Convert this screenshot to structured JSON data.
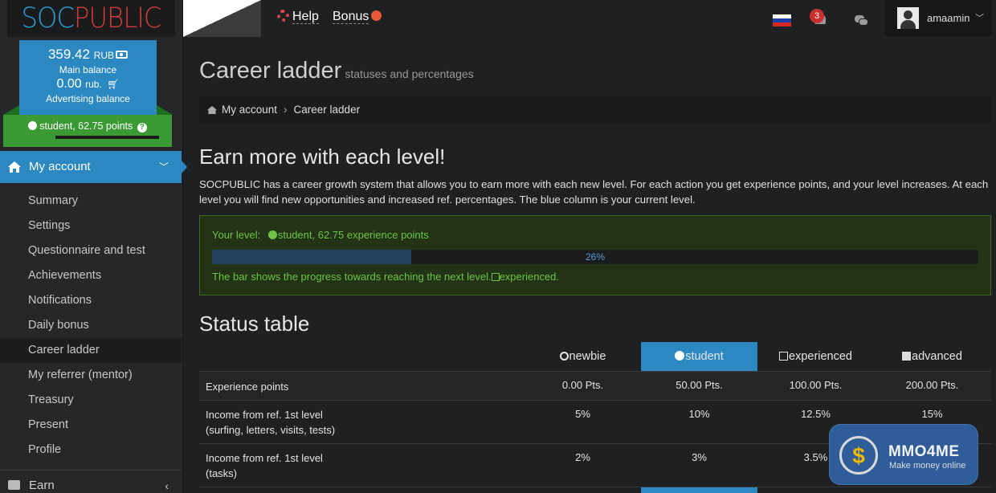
{
  "brand": {
    "part1": "SOC",
    "part2": "PUBLIC"
  },
  "balance": {
    "main_amount": "359.42",
    "main_currency": "RUB",
    "main_label": "Main balance",
    "adv_amount": "0.00",
    "adv_currency": "rub.",
    "adv_label": "Advertising balance"
  },
  "status": {
    "text": "student, 62.75 points",
    "progress_percent": 26
  },
  "nav": {
    "my_account": "My account",
    "items": [
      {
        "label": "Summary"
      },
      {
        "label": "Settings"
      },
      {
        "label": "Questionnaire and test"
      },
      {
        "label": "Achievements"
      },
      {
        "label": "Notifications"
      },
      {
        "label": "Daily bonus"
      },
      {
        "label": "Career ladder",
        "active": true
      },
      {
        "label": "My referrer (mentor)"
      },
      {
        "label": "Treasury"
      },
      {
        "label": "Present"
      },
      {
        "label": "Profile"
      }
    ],
    "earn": "Earn"
  },
  "topbar": {
    "help": "Help",
    "bonus": "Bonus",
    "notif_count": "3",
    "username": "amaamin",
    "flag_colors": [
      "#ffffff",
      "#1c3fa8",
      "#d52b1e"
    ]
  },
  "page": {
    "title": "Career ladder",
    "subtitle": "statuses and percentages",
    "breadcrumb": [
      "My account",
      "Career ladder"
    ]
  },
  "earn": {
    "heading": "Earn more with each level!",
    "text": "SOCPUBLIC has a career growth system that allows you to earn more with each new level. For each action you get experience points, and your level increases. At each level you will find new opportunities and increased ref. percentages. The blue column is your current level."
  },
  "level": {
    "label": "Your level:",
    "value": "student, 62.75 experience points",
    "percent_text": "26%",
    "progress_percent": 26,
    "note": "The bar shows the progress towards reaching the next level.",
    "next": "experienced."
  },
  "status_table": {
    "heading": "Status table",
    "columns": [
      "newbie",
      "student",
      "experienced",
      "advanced"
    ],
    "current_column": "student",
    "rows": [
      {
        "label": "Experience points",
        "values": [
          "0.00 Pts.",
          "50.00 Pts.",
          "100.00 Pts.",
          "200.00 Pts."
        ]
      },
      {
        "label": "Income from ref. 1st level",
        "label2": "(surfing, letters, visits, tests)",
        "values": [
          "5%",
          "10%",
          "12.5%",
          "15%"
        ]
      },
      {
        "label": "Income from ref. 1st level",
        "label2": "(tasks)",
        "values": [
          "2%",
          "3%",
          "3.5%",
          ""
        ]
      }
    ]
  },
  "watermark": {
    "title": "MMO4ME",
    "sub": "Make money online",
    "symbol": "$"
  }
}
